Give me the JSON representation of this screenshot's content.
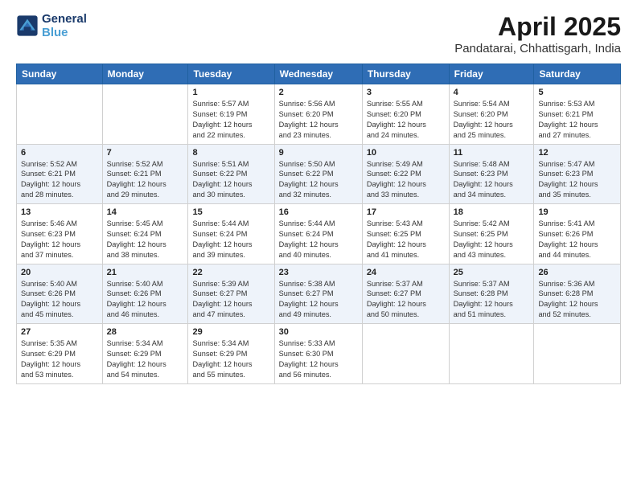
{
  "header": {
    "logo_line1": "General",
    "logo_line2": "Blue",
    "title": "April 2025",
    "subtitle": "Pandatarai, Chhattisgarh, India"
  },
  "days_of_week": [
    "Sunday",
    "Monday",
    "Tuesday",
    "Wednesday",
    "Thursday",
    "Friday",
    "Saturday"
  ],
  "weeks": [
    [
      {
        "day": "",
        "info": ""
      },
      {
        "day": "",
        "info": ""
      },
      {
        "day": "1",
        "info": "Sunrise: 5:57 AM\nSunset: 6:19 PM\nDaylight: 12 hours\nand 22 minutes."
      },
      {
        "day": "2",
        "info": "Sunrise: 5:56 AM\nSunset: 6:20 PM\nDaylight: 12 hours\nand 23 minutes."
      },
      {
        "day": "3",
        "info": "Sunrise: 5:55 AM\nSunset: 6:20 PM\nDaylight: 12 hours\nand 24 minutes."
      },
      {
        "day": "4",
        "info": "Sunrise: 5:54 AM\nSunset: 6:20 PM\nDaylight: 12 hours\nand 25 minutes."
      },
      {
        "day": "5",
        "info": "Sunrise: 5:53 AM\nSunset: 6:21 PM\nDaylight: 12 hours\nand 27 minutes."
      }
    ],
    [
      {
        "day": "6",
        "info": "Sunrise: 5:52 AM\nSunset: 6:21 PM\nDaylight: 12 hours\nand 28 minutes."
      },
      {
        "day": "7",
        "info": "Sunrise: 5:52 AM\nSunset: 6:21 PM\nDaylight: 12 hours\nand 29 minutes."
      },
      {
        "day": "8",
        "info": "Sunrise: 5:51 AM\nSunset: 6:22 PM\nDaylight: 12 hours\nand 30 minutes."
      },
      {
        "day": "9",
        "info": "Sunrise: 5:50 AM\nSunset: 6:22 PM\nDaylight: 12 hours\nand 32 minutes."
      },
      {
        "day": "10",
        "info": "Sunrise: 5:49 AM\nSunset: 6:22 PM\nDaylight: 12 hours\nand 33 minutes."
      },
      {
        "day": "11",
        "info": "Sunrise: 5:48 AM\nSunset: 6:23 PM\nDaylight: 12 hours\nand 34 minutes."
      },
      {
        "day": "12",
        "info": "Sunrise: 5:47 AM\nSunset: 6:23 PM\nDaylight: 12 hours\nand 35 minutes."
      }
    ],
    [
      {
        "day": "13",
        "info": "Sunrise: 5:46 AM\nSunset: 6:23 PM\nDaylight: 12 hours\nand 37 minutes."
      },
      {
        "day": "14",
        "info": "Sunrise: 5:45 AM\nSunset: 6:24 PM\nDaylight: 12 hours\nand 38 minutes."
      },
      {
        "day": "15",
        "info": "Sunrise: 5:44 AM\nSunset: 6:24 PM\nDaylight: 12 hours\nand 39 minutes."
      },
      {
        "day": "16",
        "info": "Sunrise: 5:44 AM\nSunset: 6:24 PM\nDaylight: 12 hours\nand 40 minutes."
      },
      {
        "day": "17",
        "info": "Sunrise: 5:43 AM\nSunset: 6:25 PM\nDaylight: 12 hours\nand 41 minutes."
      },
      {
        "day": "18",
        "info": "Sunrise: 5:42 AM\nSunset: 6:25 PM\nDaylight: 12 hours\nand 43 minutes."
      },
      {
        "day": "19",
        "info": "Sunrise: 5:41 AM\nSunset: 6:26 PM\nDaylight: 12 hours\nand 44 minutes."
      }
    ],
    [
      {
        "day": "20",
        "info": "Sunrise: 5:40 AM\nSunset: 6:26 PM\nDaylight: 12 hours\nand 45 minutes."
      },
      {
        "day": "21",
        "info": "Sunrise: 5:40 AM\nSunset: 6:26 PM\nDaylight: 12 hours\nand 46 minutes."
      },
      {
        "day": "22",
        "info": "Sunrise: 5:39 AM\nSunset: 6:27 PM\nDaylight: 12 hours\nand 47 minutes."
      },
      {
        "day": "23",
        "info": "Sunrise: 5:38 AM\nSunset: 6:27 PM\nDaylight: 12 hours\nand 49 minutes."
      },
      {
        "day": "24",
        "info": "Sunrise: 5:37 AM\nSunset: 6:27 PM\nDaylight: 12 hours\nand 50 minutes."
      },
      {
        "day": "25",
        "info": "Sunrise: 5:37 AM\nSunset: 6:28 PM\nDaylight: 12 hours\nand 51 minutes."
      },
      {
        "day": "26",
        "info": "Sunrise: 5:36 AM\nSunset: 6:28 PM\nDaylight: 12 hours\nand 52 minutes."
      }
    ],
    [
      {
        "day": "27",
        "info": "Sunrise: 5:35 AM\nSunset: 6:29 PM\nDaylight: 12 hours\nand 53 minutes."
      },
      {
        "day": "28",
        "info": "Sunrise: 5:34 AM\nSunset: 6:29 PM\nDaylight: 12 hours\nand 54 minutes."
      },
      {
        "day": "29",
        "info": "Sunrise: 5:34 AM\nSunset: 6:29 PM\nDaylight: 12 hours\nand 55 minutes."
      },
      {
        "day": "30",
        "info": "Sunrise: 5:33 AM\nSunset: 6:30 PM\nDaylight: 12 hours\nand 56 minutes."
      },
      {
        "day": "",
        "info": ""
      },
      {
        "day": "",
        "info": ""
      },
      {
        "day": "",
        "info": ""
      }
    ]
  ]
}
